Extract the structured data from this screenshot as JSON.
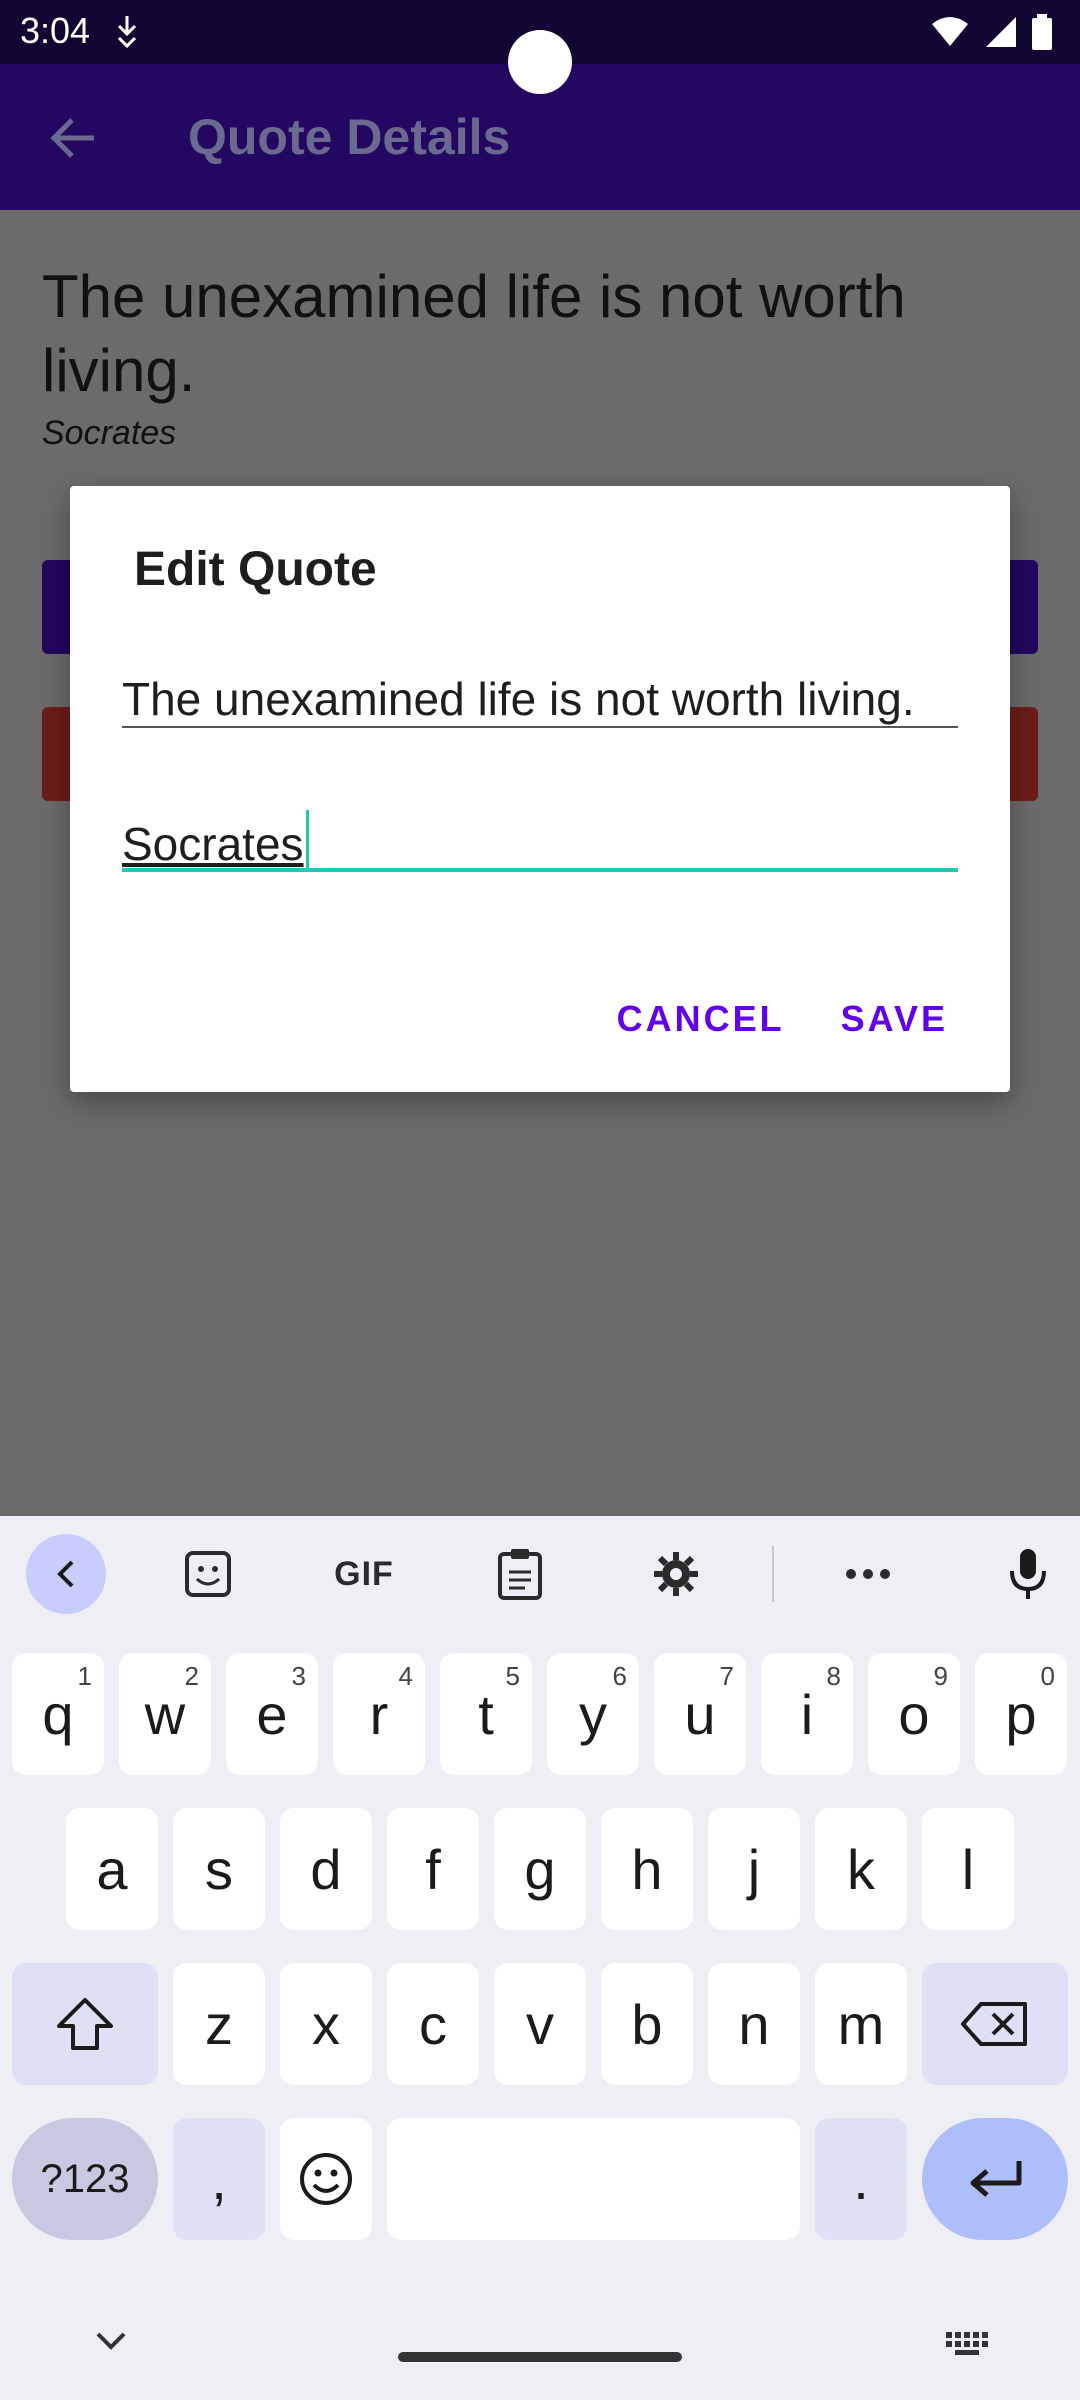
{
  "status_bar": {
    "time": "3:04",
    "icons": [
      "data-saver-icon",
      "wifi-icon",
      "signal-icon",
      "battery-icon"
    ]
  },
  "app_bar": {
    "title": "Quote Details",
    "back_icon": "arrow-left-icon"
  },
  "content": {
    "quote": "The unexamined life is not worth living.",
    "author": "Socrates"
  },
  "dialog": {
    "title": "Edit Quote",
    "quote_value": "The unexamined life is not worth living.",
    "author_value": "Socrates",
    "cancel_label": "CANCEL",
    "save_label": "SAVE"
  },
  "keyboard": {
    "toolbar": {
      "gif_label": "GIF",
      "icons": [
        "chevron-left-icon",
        "sticker-icon",
        "gif-icon",
        "clipboard-icon",
        "gear-icon",
        "more-icon",
        "mic-icon"
      ]
    },
    "row1": [
      {
        "label": "q",
        "hint": "1"
      },
      {
        "label": "w",
        "hint": "2"
      },
      {
        "label": "e",
        "hint": "3"
      },
      {
        "label": "r",
        "hint": "4"
      },
      {
        "label": "t",
        "hint": "5"
      },
      {
        "label": "y",
        "hint": "6"
      },
      {
        "label": "u",
        "hint": "7"
      },
      {
        "label": "i",
        "hint": "8"
      },
      {
        "label": "o",
        "hint": "9"
      },
      {
        "label": "p",
        "hint": "0"
      }
    ],
    "row2": [
      "a",
      "s",
      "d",
      "f",
      "g",
      "h",
      "j",
      "k",
      "l"
    ],
    "row3": [
      "z",
      "x",
      "c",
      "v",
      "b",
      "n",
      "m"
    ],
    "symbols_label": "?123",
    "comma_label": ",",
    "period_label": ".",
    "colors": {
      "accent": "#aebef8",
      "teal": "#1bcbb6",
      "purple": "#6200ee"
    }
  }
}
